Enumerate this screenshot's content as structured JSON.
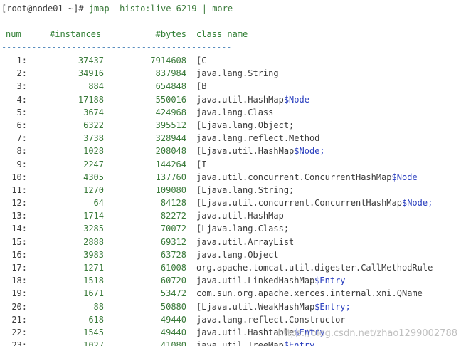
{
  "command_line": {
    "prompt": "[root@node01 ~]#",
    "command": " jmap -histo:live 6219 | more"
  },
  "header": {
    "num": "num",
    "instances": "#instances",
    "bytes": "#bytes",
    "class_name": "class name"
  },
  "separator": "----------------------------------------------",
  "rows": [
    {
      "num": "1:",
      "instances": "37437",
      "bytes": "7914608",
      "class_base": "[C",
      "class_suffix": ""
    },
    {
      "num": "2:",
      "instances": "34916",
      "bytes": "837984",
      "class_base": "java.lang.String",
      "class_suffix": ""
    },
    {
      "num": "3:",
      "instances": "884",
      "bytes": "654848",
      "class_base": "[B",
      "class_suffix": ""
    },
    {
      "num": "4:",
      "instances": "17188",
      "bytes": "550016",
      "class_base": "java.util.HashMap",
      "class_suffix": "$Node"
    },
    {
      "num": "5:",
      "instances": "3674",
      "bytes": "424968",
      "class_base": "java.lang.Class",
      "class_suffix": ""
    },
    {
      "num": "6:",
      "instances": "6322",
      "bytes": "395512",
      "class_base": "[Ljava.lang.Object;",
      "class_suffix": ""
    },
    {
      "num": "7:",
      "instances": "3738",
      "bytes": "328944",
      "class_base": "java.lang.reflect.Method",
      "class_suffix": ""
    },
    {
      "num": "8:",
      "instances": "1028",
      "bytes": "208048",
      "class_base": "[Ljava.util.HashMap",
      "class_suffix": "$Node;"
    },
    {
      "num": "9:",
      "instances": "2247",
      "bytes": "144264",
      "class_base": "[I",
      "class_suffix": ""
    },
    {
      "num": "10:",
      "instances": "4305",
      "bytes": "137760",
      "class_base": "java.util.concurrent.ConcurrentHashMap",
      "class_suffix": "$Node"
    },
    {
      "num": "11:",
      "instances": "1270",
      "bytes": "109080",
      "class_base": "[Ljava.lang.String;",
      "class_suffix": ""
    },
    {
      "num": "12:",
      "instances": "64",
      "bytes": "84128",
      "class_base": "[Ljava.util.concurrent.ConcurrentHashMap",
      "class_suffix": "$Node;"
    },
    {
      "num": "13:",
      "instances": "1714",
      "bytes": "82272",
      "class_base": "java.util.HashMap",
      "class_suffix": ""
    },
    {
      "num": "14:",
      "instances": "3285",
      "bytes": "70072",
      "class_base": "[Ljava.lang.Class;",
      "class_suffix": ""
    },
    {
      "num": "15:",
      "instances": "2888",
      "bytes": "69312",
      "class_base": "java.util.ArrayList",
      "class_suffix": ""
    },
    {
      "num": "16:",
      "instances": "3983",
      "bytes": "63728",
      "class_base": "java.lang.Object",
      "class_suffix": ""
    },
    {
      "num": "17:",
      "instances": "1271",
      "bytes": "61008",
      "class_base": "org.apache.tomcat.util.digester.CallMethodRule",
      "class_suffix": ""
    },
    {
      "num": "18:",
      "instances": "1518",
      "bytes": "60720",
      "class_base": "java.util.LinkedHashMap",
      "class_suffix": "$Entry"
    },
    {
      "num": "19:",
      "instances": "1671",
      "bytes": "53472",
      "class_base": "com.sun.org.apache.xerces.internal.xni.QName",
      "class_suffix": ""
    },
    {
      "num": "20:",
      "instances": "88",
      "bytes": "50880",
      "class_base": "[Ljava.util.WeakHashMap",
      "class_suffix": "$Entry;"
    },
    {
      "num": "21:",
      "instances": "618",
      "bytes": "49440",
      "class_base": "java.lang.reflect.Constructor",
      "class_suffix": ""
    },
    {
      "num": "22:",
      "instances": "1545",
      "bytes": "49440",
      "class_base": "java.util.Hashtable",
      "class_suffix": "$Entry"
    },
    {
      "num": "23:",
      "instances": "1027",
      "bytes": "41080",
      "class_base": "java.util.TreeMap",
      "class_suffix": "$Entry"
    }
  ],
  "watermark": "https://blog.csdn.net/zhao1299002788"
}
